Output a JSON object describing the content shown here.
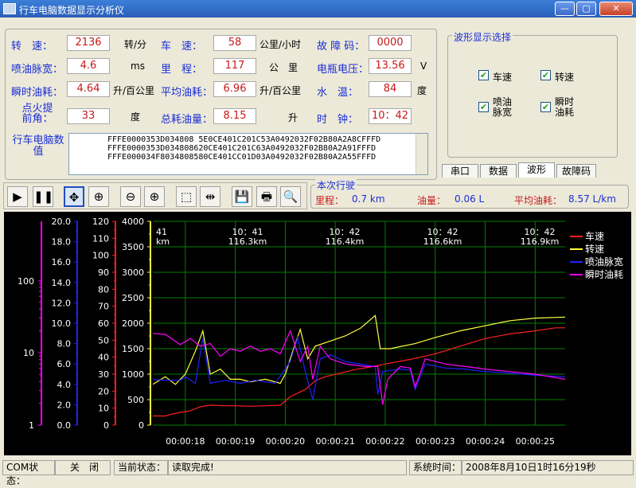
{
  "window": {
    "title": "行车电脑数据显示分析仪",
    "buttons": [
      "minimize-button",
      "maximize-button",
      "close-button"
    ]
  },
  "params": [
    {
      "key": "speed_rpm",
      "label": "转　速：",
      "value": "2136",
      "unit": "转/分"
    },
    {
      "key": "speed",
      "label": "车　速：",
      "value": "58",
      "unit": "公里/小时"
    },
    {
      "key": "fault",
      "label": "故 障 码：",
      "value": "0000",
      "unit": ""
    },
    {
      "key": "pulse",
      "label": "喷油脉宽：",
      "value": "4.6",
      "unit": "ms"
    },
    {
      "key": "mileage",
      "label": "里　程：",
      "value": "117",
      "unit": "公　里"
    },
    {
      "key": "voltage",
      "label": "电瓶电压：",
      "value": "13.56",
      "unit": "V"
    },
    {
      "key": "inst_fuel",
      "label": "瞬时油耗：",
      "value": "4.64",
      "unit": "升/百公里"
    },
    {
      "key": "avg_fuel",
      "label": "平均油耗：",
      "value": "6.96",
      "unit": "升/百公里"
    },
    {
      "key": "water",
      "label": "水　温：",
      "value": "84",
      "unit": "度"
    },
    {
      "key": "ignition",
      "label": "点火提前角：",
      "value": "33",
      "unit": "度"
    },
    {
      "key": "total_fuel",
      "label": "总耗油量：",
      "value": "8.15",
      "unit": "升"
    },
    {
      "key": "clock",
      "label": "时　钟：",
      "value": "10：42",
      "unit": ""
    }
  ],
  "raw": {
    "label": "行车电脑数　值",
    "lines": [
      "FFFE0000353D034808 5E0CE401C201C53A0492032F02B80A2A8CFFFD",
      "FFFE0000353D034808620CE401C201C63A0492032F02B80A2A91FFFD",
      "FFFE000034F8034808580CE401CC01D03A0492032F02B80A2A55FFFD"
    ]
  },
  "wave_select": {
    "title": "波形显示选择",
    "options": [
      {
        "label": "车速",
        "checked": true
      },
      {
        "label": "转速",
        "checked": true
      },
      {
        "label": "喷油脉宽",
        "checked": true
      },
      {
        "label": "瞬时油耗",
        "checked": true
      }
    ]
  },
  "tabs": [
    {
      "label": "串口",
      "active": false
    },
    {
      "label": "数据",
      "active": false
    },
    {
      "label": "波形",
      "active": true
    },
    {
      "label": "故障码",
      "active": false
    }
  ],
  "toolbar": [
    {
      "name": "play-button",
      "glyph": "▶"
    },
    {
      "name": "pause-button",
      "glyph": "❚❚"
    },
    {
      "name": "pan-button",
      "glyph": "✥"
    },
    {
      "name": "zoom-fit-button",
      "glyph": "⊕"
    },
    {
      "name": "zoom-out-button",
      "glyph": "⊖"
    },
    {
      "name": "zoom-in-button",
      "glyph": "⊕"
    },
    {
      "name": "select-button",
      "glyph": "⬚"
    },
    {
      "name": "split-button",
      "glyph": "⇹"
    },
    {
      "name": "save-button",
      "glyph": "💾"
    },
    {
      "name": "print-button",
      "glyph": "🖶"
    },
    {
      "name": "preview-button",
      "glyph": "🔍"
    }
  ],
  "trip": {
    "title": "本次行驶",
    "mileage_label": "里程：",
    "mileage": "0.7 km",
    "fuel_label": "油量：",
    "fuel": "0.06 L",
    "avg_label": "平均油耗：",
    "avg": "8.57 L/km"
  },
  "status": {
    "com_label": "COM状态：",
    "com_value": "关　闭",
    "cur_label": "当前状态：",
    "cur_value": "读取完成!",
    "time_label": "系统时间：",
    "time_value": "2008年8月10日1时16分19秒"
  },
  "chart_data": {
    "type": "line",
    "axes": [
      {
        "name": "瞬时油耗",
        "color": "#ff00ff",
        "scale": "log",
        "ticks": [
          "100",
          "10",
          "1"
        ]
      },
      {
        "name": "喷油脉宽",
        "color": "#2020ff",
        "ticks": [
          "20.0",
          "18.0",
          "16.0",
          "14.0",
          "12.0",
          "10.0",
          "8.0",
          "6.0",
          "4.0",
          "2.0",
          "0.0"
        ]
      },
      {
        "name": "车速",
        "color": "#ff2020",
        "ticks": [
          "120",
          "110",
          "100",
          "90",
          "80",
          "70",
          "60",
          "50",
          "40",
          "30",
          "20",
          "10",
          "0"
        ]
      },
      {
        "name": "转速",
        "color": "#ffff40",
        "ticks": [
          "4000",
          "3500",
          "3000",
          "2500",
          "2000",
          "1500",
          "1000",
          "500",
          "0"
        ]
      }
    ],
    "ylim": [
      0,
      4000
    ],
    "top_markers": [
      {
        "time": "41",
        "km": "km"
      },
      {
        "time": "10：41",
        "km": "116.3km"
      },
      {
        "time": "10：42",
        "km": "116.4km"
      },
      {
        "time": "10：42",
        "km": "116.6km"
      },
      {
        "time": "10：42",
        "km": "116.9km"
      }
    ],
    "x_ticks": [
      "00:00:18",
      "00:00:19",
      "00:00:20",
      "00:00:21",
      "00:00:22",
      "00:00:23",
      "00:00:24",
      "00:00:25"
    ],
    "x_range_seconds": [
      17.35,
      25.6
    ],
    "series": [
      {
        "name": "车速",
        "color": "#ff2020",
        "points": [
          [
            17.35,
            180
          ],
          [
            17.6,
            180
          ],
          [
            17.75,
            220
          ],
          [
            17.9,
            250
          ],
          [
            18.1,
            280
          ],
          [
            18.3,
            360
          ],
          [
            18.5,
            390
          ],
          [
            18.8,
            380
          ],
          [
            19.0,
            380
          ],
          [
            19.3,
            370
          ],
          [
            19.6,
            380
          ],
          [
            19.9,
            390
          ],
          [
            20.1,
            560
          ],
          [
            20.4,
            700
          ],
          [
            20.6,
            870
          ],
          [
            20.8,
            950
          ],
          [
            21.1,
            1020
          ],
          [
            21.4,
            1090
          ],
          [
            21.7,
            1140
          ],
          [
            22.0,
            1200
          ],
          [
            22.5,
            1290
          ],
          [
            23.0,
            1400
          ],
          [
            23.5,
            1550
          ],
          [
            24.0,
            1700
          ],
          [
            24.5,
            1790
          ],
          [
            25.0,
            1850
          ],
          [
            25.4,
            1910
          ],
          [
            25.6,
            1910
          ]
        ]
      },
      {
        "name": "转速",
        "color": "#ffff40",
        "points": [
          [
            17.35,
            800
          ],
          [
            17.6,
            950
          ],
          [
            17.8,
            800
          ],
          [
            18.0,
            1000
          ],
          [
            18.2,
            1450
          ],
          [
            18.35,
            1850
          ],
          [
            18.5,
            1000
          ],
          [
            18.7,
            1100
          ],
          [
            18.9,
            900
          ],
          [
            19.1,
            900
          ],
          [
            19.3,
            850
          ],
          [
            19.6,
            900
          ],
          [
            19.9,
            820
          ],
          [
            20.0,
            1000
          ],
          [
            20.15,
            1450
          ],
          [
            20.3,
            1880
          ],
          [
            20.45,
            1300
          ],
          [
            20.6,
            1550
          ],
          [
            20.9,
            1650
          ],
          [
            21.2,
            1750
          ],
          [
            21.5,
            1900
          ],
          [
            21.8,
            2150
          ],
          [
            21.9,
            1500
          ],
          [
            22.1,
            1500
          ],
          [
            22.6,
            1600
          ],
          [
            23.0,
            1720
          ],
          [
            23.5,
            1850
          ],
          [
            24.0,
            1950
          ],
          [
            24.5,
            2050
          ],
          [
            25.0,
            2100
          ],
          [
            25.6,
            2120
          ]
        ]
      },
      {
        "name": "喷油脉宽",
        "color": "#2020ff",
        "points": [
          [
            17.35,
            900
          ],
          [
            17.6,
            880
          ],
          [
            17.9,
            880
          ],
          [
            18.0,
            950
          ],
          [
            18.2,
            820
          ],
          [
            18.35,
            1700
          ],
          [
            18.5,
            820
          ],
          [
            18.8,
            880
          ],
          [
            19.1,
            820
          ],
          [
            19.4,
            880
          ],
          [
            19.8,
            820
          ],
          [
            20.1,
            1250
          ],
          [
            20.25,
            1720
          ],
          [
            20.4,
            1050
          ],
          [
            20.55,
            500
          ],
          [
            20.7,
            1300
          ],
          [
            20.9,
            1380
          ],
          [
            21.2,
            1250
          ],
          [
            21.6,
            1180
          ],
          [
            21.8,
            1150
          ],
          [
            21.85,
            600
          ],
          [
            21.95,
            1050
          ],
          [
            22.3,
            1100
          ],
          [
            22.5,
            1080
          ],
          [
            22.6,
            700
          ],
          [
            22.8,
            1200
          ],
          [
            23.2,
            1120
          ],
          [
            23.6,
            1100
          ],
          [
            24.0,
            1050
          ],
          [
            24.5,
            1020
          ],
          [
            25.0,
            980
          ],
          [
            25.6,
            950
          ]
        ]
      },
      {
        "name": "瞬时油耗",
        "color": "#ff00ff",
        "points": [
          [
            17.35,
            1800
          ],
          [
            17.6,
            1780
          ],
          [
            17.9,
            1580
          ],
          [
            18.1,
            1700
          ],
          [
            18.3,
            1550
          ],
          [
            18.5,
            1600
          ],
          [
            18.7,
            1350
          ],
          [
            18.9,
            1500
          ],
          [
            19.1,
            1450
          ],
          [
            19.3,
            1550
          ],
          [
            19.5,
            1450
          ],
          [
            19.7,
            1500
          ],
          [
            19.9,
            1400
          ],
          [
            20.1,
            1850
          ],
          [
            20.3,
            1250
          ],
          [
            20.45,
            1550
          ],
          [
            20.55,
            900
          ],
          [
            20.7,
            1550
          ],
          [
            20.9,
            1300
          ],
          [
            21.2,
            1200
          ],
          [
            21.6,
            1150
          ],
          [
            21.85,
            1150
          ],
          [
            21.95,
            400
          ],
          [
            22.05,
            900
          ],
          [
            22.3,
            1150
          ],
          [
            22.5,
            1120
          ],
          [
            22.6,
            750
          ],
          [
            22.8,
            1300
          ],
          [
            23.2,
            1200
          ],
          [
            23.6,
            1150
          ],
          [
            24.0,
            1100
          ],
          [
            24.5,
            1050
          ],
          [
            25.0,
            1000
          ],
          [
            25.6,
            900
          ]
        ]
      }
    ]
  }
}
